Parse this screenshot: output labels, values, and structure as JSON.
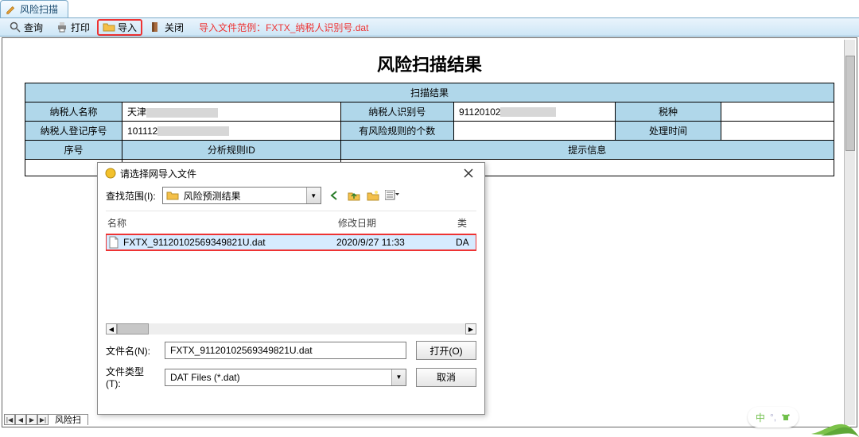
{
  "tab_title": "风险扫描",
  "toolbar": {
    "query": "查询",
    "print": "打印",
    "import": "导入",
    "close": "关闭",
    "hint": "导入文件范例：FXTX_纳税人识别号.dat"
  },
  "page_title": "风险扫描结果",
  "result_table": {
    "section_header": "扫描结果",
    "labels": {
      "taxpayer_name": "纳税人名称",
      "taxpayer_id": "纳税人识别号",
      "tax_type": "税种",
      "reg_no": "纳税人登记序号",
      "rule_count": "有风险规则的个数",
      "process_time": "处理时间",
      "seq": "序号",
      "rule_id": "分析规则ID",
      "tip": "提示信息"
    },
    "values": {
      "taxpayer_name": "天津",
      "taxpayer_id": "91120102",
      "tax_type": "",
      "reg_no": "101112",
      "rule_count": "",
      "process_time": ""
    }
  },
  "sheet_tab": "风险扫",
  "dialog": {
    "title": "请选择网导入文件",
    "look_in_label": "查找范围(I):",
    "look_in_value": "风险预测结果",
    "columns": {
      "name": "名称",
      "date": "修改日期",
      "type": "类"
    },
    "file": {
      "name": "FXTX_91120102569349821U.dat",
      "date": "2020/9/27 11:33",
      "type": "DA"
    },
    "filename_label": "文件名(N):",
    "filetype_label": "文件类型(T):",
    "filetype_value": "DAT Files (*.dat)",
    "open": "打开(O)",
    "cancel": "取消"
  },
  "ime": "中"
}
